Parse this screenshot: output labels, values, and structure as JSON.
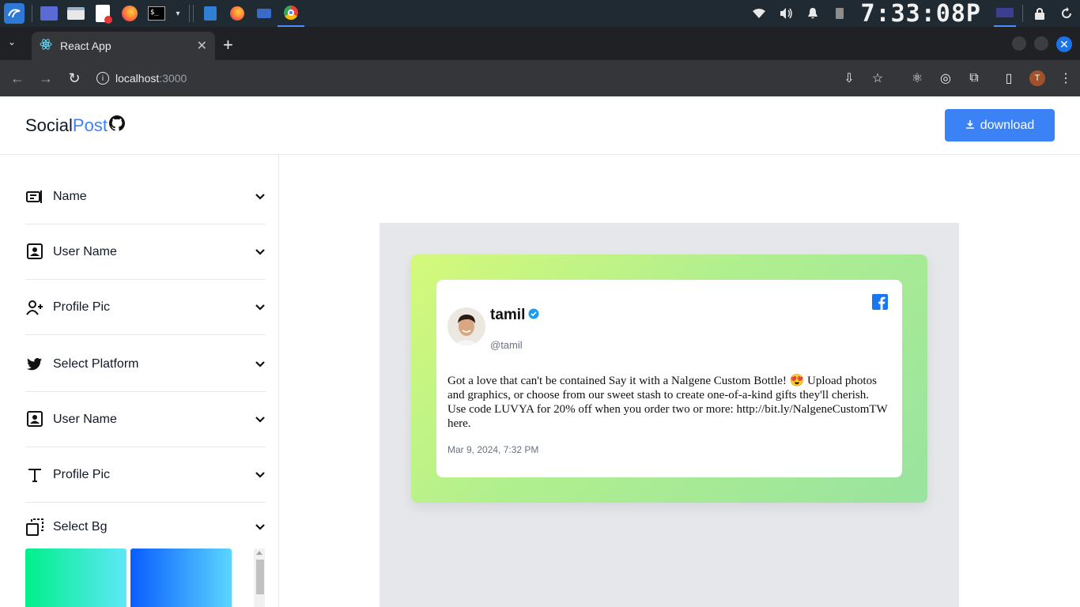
{
  "taskbar": {
    "clock": "7:33:08P"
  },
  "browser": {
    "tab_title": "React App",
    "url_host": "localhost",
    "url_port": ":3000",
    "profile_initial": "T"
  },
  "app": {
    "logo_main": "Social",
    "logo_accent": "Post",
    "download_label": "download"
  },
  "sidebar": {
    "items": [
      {
        "label": "Name",
        "icon": "name-card-icon"
      },
      {
        "label": "User Name",
        "icon": "contact-icon"
      },
      {
        "label": "Profile Pic",
        "icon": "user-plus-icon"
      },
      {
        "label": "Select Platform",
        "icon": "twitter-icon"
      },
      {
        "label": "User Name",
        "icon": "contact-icon"
      },
      {
        "label": "Profile Pic",
        "icon": "text-icon"
      },
      {
        "label": "Select Bg",
        "icon": "background-icon"
      }
    ],
    "swatches": [
      "#00f08a-#5ee7f8",
      "#0a5cff-#5ad6ff"
    ]
  },
  "post": {
    "name": "tamil",
    "handle": "@tamil",
    "text": "Got a love that can't be contained Say it with a Nalgene Custom Bottle! 😍 Upload photos and graphics, or choose from our sweet stash to create one-of-a-kind gifts they'll cherish. Use code LUVYA for 20% off when you order two or more: http://bit.ly/NalgeneCustomTW here.",
    "date": "Mar 9, 2024, 7:32 PM",
    "platform": "facebook"
  }
}
